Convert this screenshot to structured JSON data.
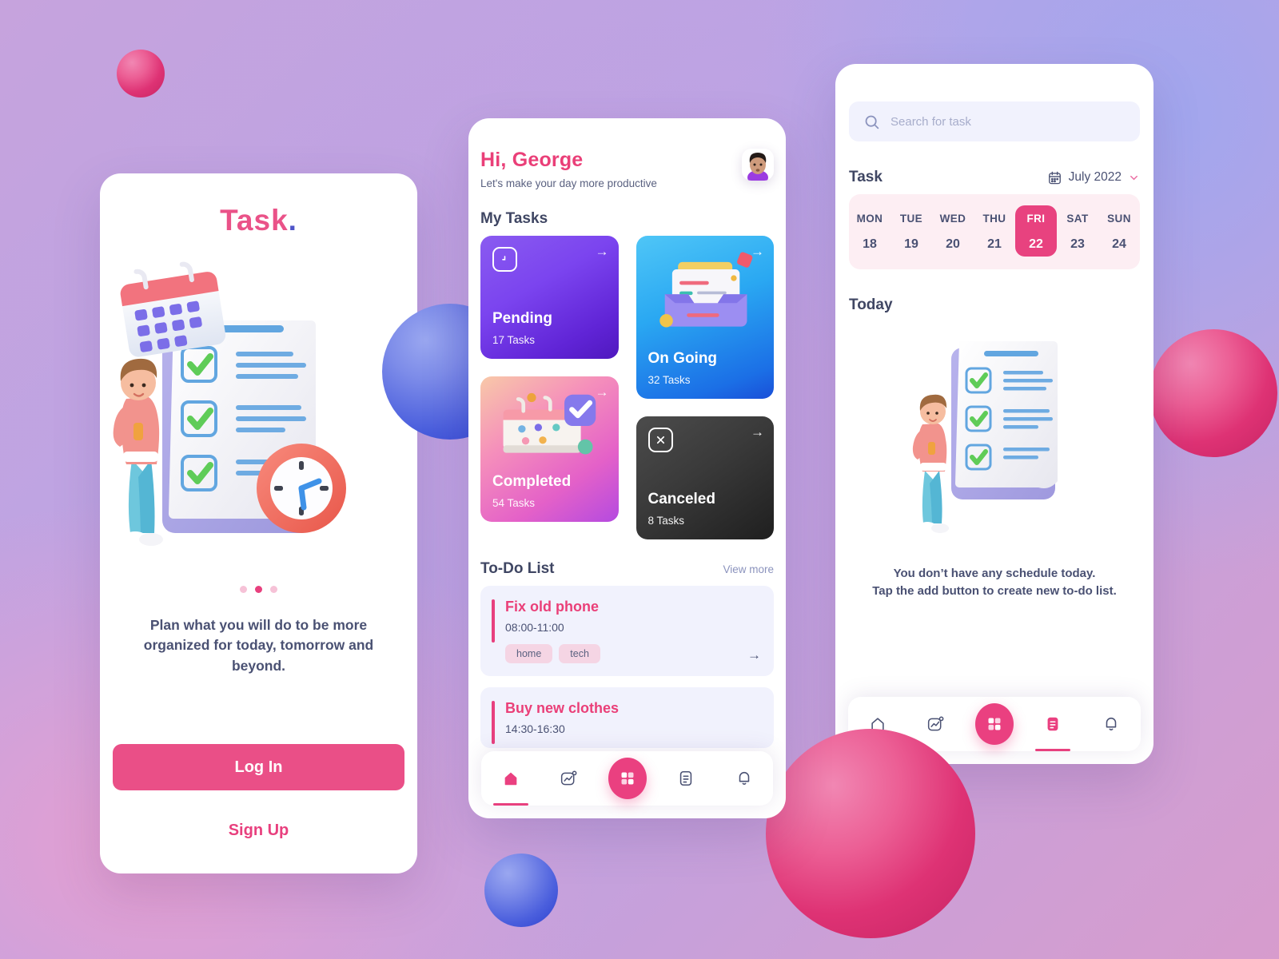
{
  "background": {
    "gradient_from": "#c6a3dd",
    "gradient_mid": "#b9a4e6",
    "gradient_to": "#d79ccd",
    "sphere_pink": "#e8407e",
    "sphere_blue": "#4b5fdd"
  },
  "onboarding": {
    "brand": "Task",
    "brand_dot": ".",
    "illustration_alt": "person-with-checklist-calendar-clock",
    "pagination": {
      "total": 3,
      "active_index": 1
    },
    "tagline": "Plan what you will do to be more organized for today, tomorrow and beyond.",
    "login_label": "Log In",
    "signup_label": "Sign Up",
    "accent": "#ea4f87"
  },
  "home": {
    "greeting": "Hi, George",
    "subtitle": "Let's make your day more productive",
    "avatar_alt": "user-avatar",
    "my_tasks_title": "My Tasks",
    "task_cards": [
      {
        "label": "Pending",
        "count": "17 Tasks",
        "icon": "clock-icon",
        "accent": "#6024d6"
      },
      {
        "label": "On Going",
        "count": "32 Tasks",
        "icon": "inbox-icon",
        "accent": "#1b6fe6"
      },
      {
        "label": "Completed",
        "count": "54 Tasks",
        "icon": "calendar-check-icon",
        "accent": "#e461c8"
      },
      {
        "label": "Canceled",
        "count": "8 Tasks",
        "icon": "close-icon",
        "accent": "#1f1f1f"
      }
    ],
    "todo_title": "To-Do List",
    "view_more": "View more",
    "todos": [
      {
        "title": "Fix old phone",
        "time": "08:00-11:00",
        "tags": [
          "home",
          "tech"
        ]
      },
      {
        "title": "Buy new clothes",
        "time": "14:30-16:30",
        "tags": []
      }
    ],
    "nav": [
      {
        "name": "home",
        "icon": "home-icon",
        "active": true
      },
      {
        "name": "stats",
        "icon": "chart-icon",
        "active": false
      },
      {
        "name": "add",
        "icon": "grid-icon",
        "active": false,
        "fab": true
      },
      {
        "name": "list",
        "icon": "document-icon",
        "active": false
      },
      {
        "name": "notifications",
        "icon": "bell-icon",
        "active": false
      }
    ]
  },
  "schedule": {
    "search": {
      "placeholder": "Search for task",
      "value": "",
      "icon": "search-icon"
    },
    "task_title": "Task",
    "month": "July 2022",
    "month_icon": "calendar-icon",
    "chevron": "chevron-down-icon",
    "week": [
      {
        "dname": "MON",
        "dnum": "18",
        "selected": false
      },
      {
        "dname": "TUE",
        "dnum": "19",
        "selected": false
      },
      {
        "dname": "WED",
        "dnum": "20",
        "selected": false
      },
      {
        "dname": "THU",
        "dnum": "21",
        "selected": false
      },
      {
        "dname": "FRI",
        "dnum": "22",
        "selected": true
      },
      {
        "dname": "SAT",
        "dnum": "23",
        "selected": false
      },
      {
        "dname": "SUN",
        "dnum": "24",
        "selected": false
      }
    ],
    "today_title": "Today",
    "illustration_alt": "person-with-checklist",
    "empty_line1": "You don’t have any schedule today.",
    "empty_line2": "Tap the add button to create new to-do list.",
    "nav": [
      {
        "name": "home",
        "icon": "home-icon",
        "active": false
      },
      {
        "name": "stats",
        "icon": "chart-icon",
        "active": false
      },
      {
        "name": "add",
        "icon": "grid-icon",
        "active": false,
        "fab": true
      },
      {
        "name": "list",
        "icon": "document-icon",
        "active": true
      },
      {
        "name": "notifications",
        "icon": "bell-icon",
        "active": false
      }
    ]
  }
}
